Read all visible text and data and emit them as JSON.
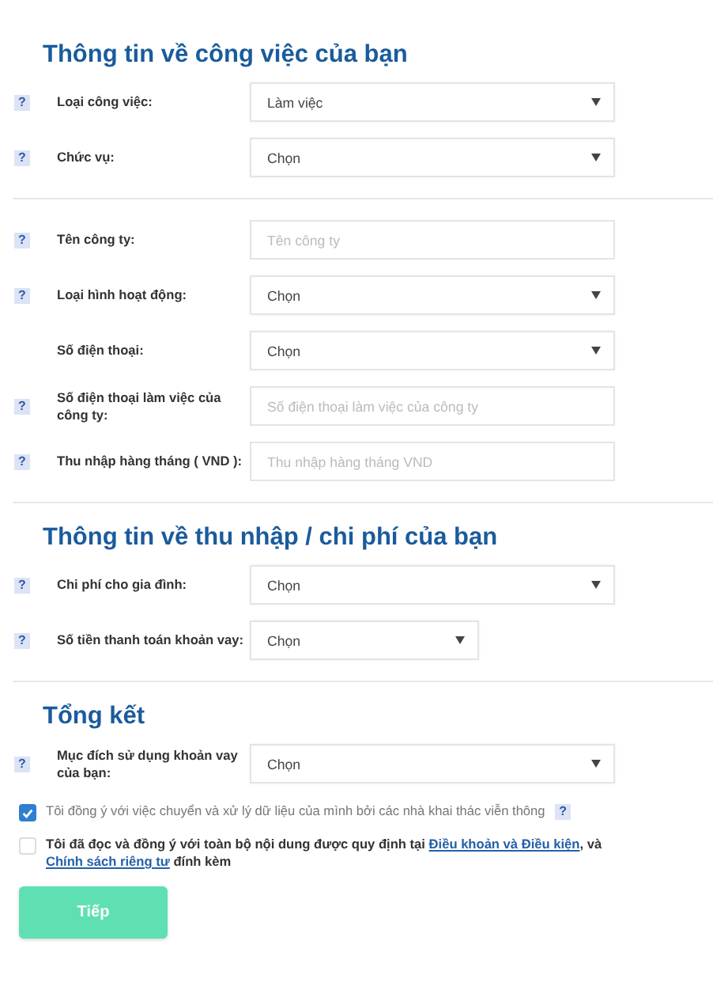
{
  "sections": [
    {
      "title": "Thông tin về công việc của bạn",
      "groups": [
        {
          "fields": [
            {
              "help": "?",
              "label": "Loại công việc:",
              "kind": "select",
              "value": "Làm việc",
              "compact": false
            },
            {
              "help": "?",
              "label": "Chức vụ:",
              "kind": "select",
              "value": "Chọn",
              "compact": false
            }
          ]
        },
        {
          "fields": [
            {
              "help": "?",
              "label": "Tên công ty:",
              "kind": "input",
              "placeholder": "Tên công ty",
              "compact": false
            },
            {
              "help": "?",
              "label": "Loại hình hoạt động:",
              "kind": "select",
              "value": "Chọn",
              "compact": false
            },
            {
              "label": "Số điện thoại:",
              "kind": "select",
              "value": "Chọn",
              "compact": false
            },
            {
              "help": "?",
              "label": "Số điện thoại làm việc của công ty:",
              "kind": "input",
              "placeholder": "Số điện thoại làm việc của công ty",
              "compact": false
            },
            {
              "help": "?",
              "label": "Thu nhập hàng tháng ( VND ):",
              "kind": "input",
              "placeholder": "Thu nhập hàng tháng VND",
              "compact": false
            }
          ]
        }
      ]
    },
    {
      "title": "Thông tin về thu nhập / chi phí của bạn",
      "groups": [
        {
          "fields": [
            {
              "help": "?",
              "label": "Chi phí cho gia đình:",
              "kind": "select",
              "value": "Chọn",
              "compact": false
            },
            {
              "help": "?",
              "label": "Số tiền thanh toán khoản vay:",
              "kind": "select",
              "value": "Chọn",
              "compact": true
            }
          ]
        }
      ]
    },
    {
      "title": "Tổng kết",
      "groups": [
        {
          "fields": [
            {
              "help": "?",
              "label": "Mục đích sử dụng khoản vay của bạn:",
              "kind": "select",
              "value": "Chọn",
              "compact": false
            }
          ]
        }
      ]
    }
  ],
  "consents": [
    {
      "checked": true,
      "help": "?",
      "parts": [
        {
          "kind": "text",
          "text": "Tôi đồng ý với việc chuyển và xử lý dữ liệu của mình bởi các nhà khai thác viễn thông"
        }
      ]
    },
    {
      "checked": false,
      "parts": [
        {
          "kind": "text",
          "text": "Tôi đã đọc và đồng ý với toàn bộ nội dung được quy định tại "
        },
        {
          "kind": "link",
          "text": "Điều khoản và Điều kiện"
        },
        {
          "kind": "text",
          "text": ", và "
        },
        {
          "kind": "link",
          "text": "Chính sách riêng tư"
        },
        {
          "kind": "text",
          "text": " đính kèm"
        }
      ]
    }
  ],
  "button": {
    "label": "Tiếp",
    "disabled": true
  }
}
